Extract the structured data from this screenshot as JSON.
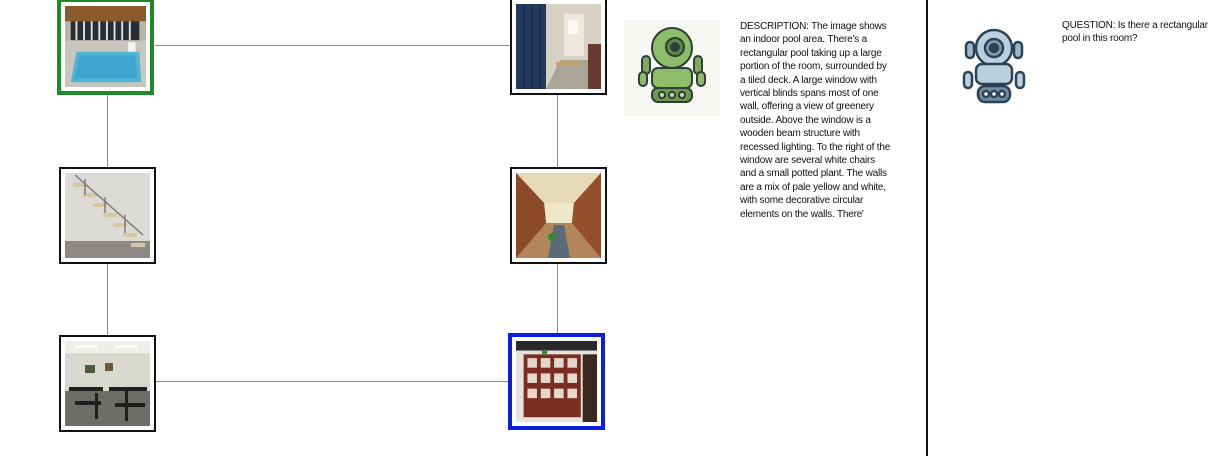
{
  "graph": {
    "nodes": [
      {
        "id": "pool",
        "scene": "indoor pool room",
        "role": "start"
      },
      {
        "id": "lockers",
        "scene": "locker room corridor",
        "role": "normal"
      },
      {
        "id": "stairs",
        "scene": "staircase",
        "role": "normal"
      },
      {
        "id": "hallway",
        "scene": "wooden hallway",
        "role": "normal"
      },
      {
        "id": "classroom",
        "scene": "room with tables and chairs",
        "role": "normal"
      },
      {
        "id": "shop",
        "scene": "shop with shelves",
        "role": "goal"
      }
    ],
    "edges": [
      [
        "pool",
        "lockers"
      ],
      [
        "pool",
        "stairs"
      ],
      [
        "stairs",
        "classroom"
      ],
      [
        "classroom",
        "shop"
      ],
      [
        "lockers",
        "hallway"
      ],
      [
        "hallway",
        "shop"
      ]
    ],
    "colors": {
      "start": "#1e8a2a",
      "goal": "#0a1ee0",
      "edge": "#8a8a8a"
    }
  },
  "describer": {
    "avatar_icon": "green-robot-icon",
    "text": "DESCRIPTION: The image shows an indoor pool area. There's a rectangular pool taking up a large portion of the room, surrounded by a tiled deck. A large window with vertical blinds spans most of one wall, offering a view of greenery outside. Above the window is a wooden beam structure with recessed lighting. To the right of the window are several white chairs and a small potted plant. The walls are a mix of pale yellow and white, with some decorative circular elements on the walls. There'"
  },
  "questioner": {
    "avatar_icon": "blue-robot-icon",
    "text": "QUESTION: Is there a rectangular pool in this room?"
  }
}
